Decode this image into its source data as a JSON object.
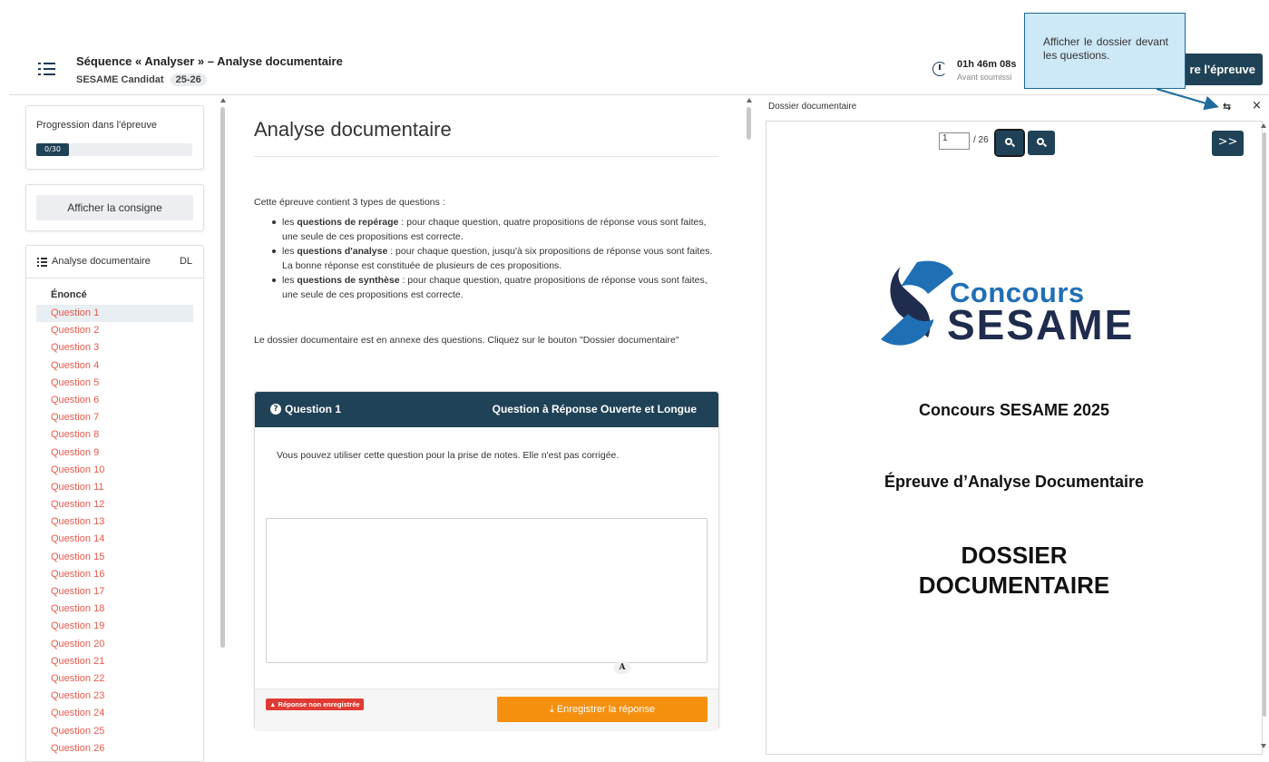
{
  "header": {
    "sequence_title": "Séquence « Analyser » – Analyse documentaire",
    "candidate": "SESAME Candidat",
    "year_badge": "25-26",
    "timer_value": "01h 46m 08s",
    "timer_label": "Avant soumissi",
    "finish_button": "re l'épreuve",
    "tooltip": "Afficher le dossier devant les questions."
  },
  "sidebar": {
    "progress_label": "Progression dans l'épreuve",
    "progress_text": "0/30",
    "progress_fraction": 0.0,
    "consigne_button": "Afficher la consigne",
    "nav_title": "Analyse documentaire",
    "nav_code": "DL",
    "enonce": "Énoncé",
    "questions": [
      "Question 1",
      "Question 2",
      "Question 3",
      "Question 4",
      "Question 5",
      "Question 6",
      "Question 7",
      "Question 8",
      "Question 9",
      "Question 10",
      "Question 11",
      "Question 12",
      "Question 13",
      "Question 14",
      "Question 15",
      "Question 16",
      "Question 17",
      "Question 18",
      "Question 19",
      "Question 20",
      "Question 21",
      "Question 22",
      "Question 23",
      "Question 24",
      "Question 25",
      "Question 26"
    ],
    "active_question": 0
  },
  "main": {
    "title": "Analyse documentaire",
    "intro": "Cette épreuve contient 3 types de questions :",
    "bullets": [
      {
        "prefix": "les ",
        "strong": "questions de repérage",
        "rest": " : pour chaque question, quatre propositions de réponse vous sont faites, une seule de ces propositions est correcte."
      },
      {
        "prefix": "les ",
        "strong": "questions d'analyse",
        "rest": " : pour chaque question, jusqu'à six propositions de réponse vous sont faites. La bonne réponse est constituée de plusieurs de ces propositions."
      },
      {
        "prefix": "les ",
        "strong": "questions de synthèse",
        "rest": " : pour chaque question, quatre propositions de réponse vous sont faites, une seule de ces propositions est correcte."
      }
    ],
    "annex_text": "Le dossier documentaire est en annexe des questions. Cliquez sur le bouton \"Dossier documentaire\"",
    "question": {
      "title": "Question 1",
      "type": "Question à Réponse Ouverte et Longue",
      "body": "Vous pouvez utiliser cette question pour la prise de notes. Elle n'est pas corrigée.",
      "answer": "",
      "font_button": "A",
      "status_badge": "Réponse non enregistrée",
      "save_button": "Enregistrer la réponse"
    }
  },
  "dossier": {
    "label": "Dossier documentaire",
    "page_input": "1",
    "page_total": "/ 26",
    "next_button": ">>",
    "logo_line1": "Concours",
    "logo_line2": "SESAME",
    "line1": "Concours SESAME 2025",
    "line2": "Épreuve d’Analyse Documentaire",
    "line3a": "DOSSIER",
    "line3b": "DOCUMENTAIRE"
  },
  "colors": {
    "primary": "#1f4257",
    "accent_orange": "#f5900f",
    "link_red": "#e8594c",
    "warning_red": "#e03b33",
    "logo_blue": "#1f6fb5",
    "logo_navy": "#1f2c4d",
    "tooltip_bg": "#cde8f7"
  }
}
